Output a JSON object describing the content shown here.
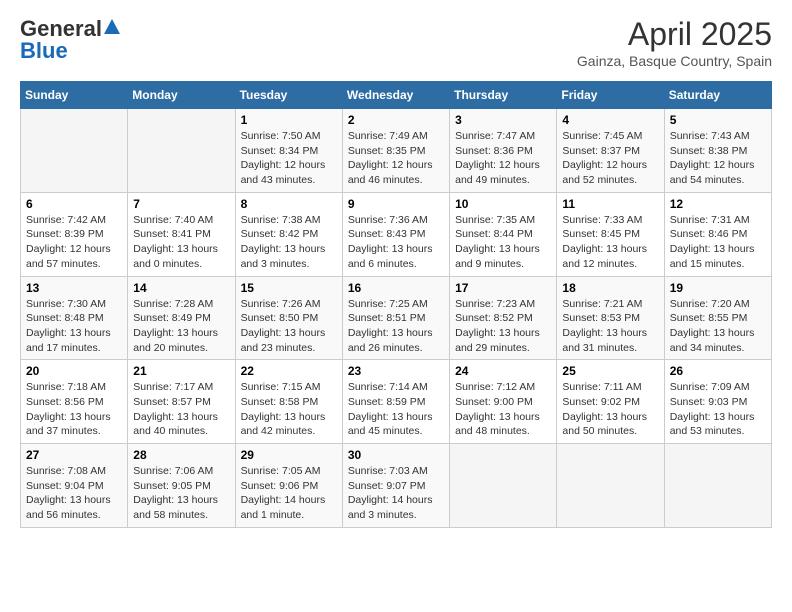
{
  "header": {
    "logo_general": "General",
    "logo_blue": "Blue",
    "month": "April 2025",
    "location": "Gainza, Basque Country, Spain"
  },
  "days_of_week": [
    "Sunday",
    "Monday",
    "Tuesday",
    "Wednesday",
    "Thursday",
    "Friday",
    "Saturday"
  ],
  "weeks": [
    [
      {
        "day": "",
        "info": ""
      },
      {
        "day": "",
        "info": ""
      },
      {
        "day": "1",
        "info": "Sunrise: 7:50 AM\nSunset: 8:34 PM\nDaylight: 12 hours and 43 minutes."
      },
      {
        "day": "2",
        "info": "Sunrise: 7:49 AM\nSunset: 8:35 PM\nDaylight: 12 hours and 46 minutes."
      },
      {
        "day": "3",
        "info": "Sunrise: 7:47 AM\nSunset: 8:36 PM\nDaylight: 12 hours and 49 minutes."
      },
      {
        "day": "4",
        "info": "Sunrise: 7:45 AM\nSunset: 8:37 PM\nDaylight: 12 hours and 52 minutes."
      },
      {
        "day": "5",
        "info": "Sunrise: 7:43 AM\nSunset: 8:38 PM\nDaylight: 12 hours and 54 minutes."
      }
    ],
    [
      {
        "day": "6",
        "info": "Sunrise: 7:42 AM\nSunset: 8:39 PM\nDaylight: 12 hours and 57 minutes."
      },
      {
        "day": "7",
        "info": "Sunrise: 7:40 AM\nSunset: 8:41 PM\nDaylight: 13 hours and 0 minutes."
      },
      {
        "day": "8",
        "info": "Sunrise: 7:38 AM\nSunset: 8:42 PM\nDaylight: 13 hours and 3 minutes."
      },
      {
        "day": "9",
        "info": "Sunrise: 7:36 AM\nSunset: 8:43 PM\nDaylight: 13 hours and 6 minutes."
      },
      {
        "day": "10",
        "info": "Sunrise: 7:35 AM\nSunset: 8:44 PM\nDaylight: 13 hours and 9 minutes."
      },
      {
        "day": "11",
        "info": "Sunrise: 7:33 AM\nSunset: 8:45 PM\nDaylight: 13 hours and 12 minutes."
      },
      {
        "day": "12",
        "info": "Sunrise: 7:31 AM\nSunset: 8:46 PM\nDaylight: 13 hours and 15 minutes."
      }
    ],
    [
      {
        "day": "13",
        "info": "Sunrise: 7:30 AM\nSunset: 8:48 PM\nDaylight: 13 hours and 17 minutes."
      },
      {
        "day": "14",
        "info": "Sunrise: 7:28 AM\nSunset: 8:49 PM\nDaylight: 13 hours and 20 minutes."
      },
      {
        "day": "15",
        "info": "Sunrise: 7:26 AM\nSunset: 8:50 PM\nDaylight: 13 hours and 23 minutes."
      },
      {
        "day": "16",
        "info": "Sunrise: 7:25 AM\nSunset: 8:51 PM\nDaylight: 13 hours and 26 minutes."
      },
      {
        "day": "17",
        "info": "Sunrise: 7:23 AM\nSunset: 8:52 PM\nDaylight: 13 hours and 29 minutes."
      },
      {
        "day": "18",
        "info": "Sunrise: 7:21 AM\nSunset: 8:53 PM\nDaylight: 13 hours and 31 minutes."
      },
      {
        "day": "19",
        "info": "Sunrise: 7:20 AM\nSunset: 8:55 PM\nDaylight: 13 hours and 34 minutes."
      }
    ],
    [
      {
        "day": "20",
        "info": "Sunrise: 7:18 AM\nSunset: 8:56 PM\nDaylight: 13 hours and 37 minutes."
      },
      {
        "day": "21",
        "info": "Sunrise: 7:17 AM\nSunset: 8:57 PM\nDaylight: 13 hours and 40 minutes."
      },
      {
        "day": "22",
        "info": "Sunrise: 7:15 AM\nSunset: 8:58 PM\nDaylight: 13 hours and 42 minutes."
      },
      {
        "day": "23",
        "info": "Sunrise: 7:14 AM\nSunset: 8:59 PM\nDaylight: 13 hours and 45 minutes."
      },
      {
        "day": "24",
        "info": "Sunrise: 7:12 AM\nSunset: 9:00 PM\nDaylight: 13 hours and 48 minutes."
      },
      {
        "day": "25",
        "info": "Sunrise: 7:11 AM\nSunset: 9:02 PM\nDaylight: 13 hours and 50 minutes."
      },
      {
        "day": "26",
        "info": "Sunrise: 7:09 AM\nSunset: 9:03 PM\nDaylight: 13 hours and 53 minutes."
      }
    ],
    [
      {
        "day": "27",
        "info": "Sunrise: 7:08 AM\nSunset: 9:04 PM\nDaylight: 13 hours and 56 minutes."
      },
      {
        "day": "28",
        "info": "Sunrise: 7:06 AM\nSunset: 9:05 PM\nDaylight: 13 hours and 58 minutes."
      },
      {
        "day": "29",
        "info": "Sunrise: 7:05 AM\nSunset: 9:06 PM\nDaylight: 14 hours and 1 minute."
      },
      {
        "day": "30",
        "info": "Sunrise: 7:03 AM\nSunset: 9:07 PM\nDaylight: 14 hours and 3 minutes."
      },
      {
        "day": "",
        "info": ""
      },
      {
        "day": "",
        "info": ""
      },
      {
        "day": "",
        "info": ""
      }
    ]
  ]
}
